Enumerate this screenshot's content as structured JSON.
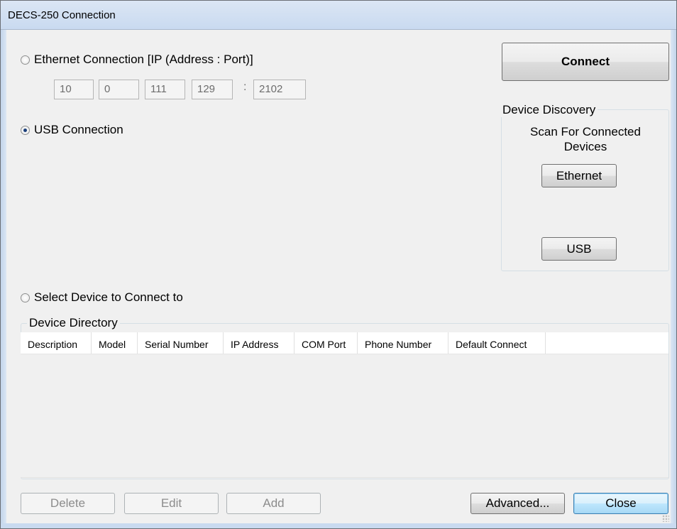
{
  "window": {
    "title": "DECS-250 Connection"
  },
  "ethernet": {
    "radio_label": "Ethernet Connection [IP (Address : Port)]",
    "ip_octets": [
      "10",
      "0",
      "111",
      "129"
    ],
    "port_separator": ":",
    "port": "2102",
    "selected": false
  },
  "usb": {
    "radio_label": "USB Connection",
    "selected": true
  },
  "select_device": {
    "radio_label": "Select Device to Connect to",
    "selected": false
  },
  "connect_button": "Connect",
  "discovery": {
    "title": "Device Discovery",
    "scan_text_line1": "Scan For Connected",
    "scan_text_line2": "Devices",
    "ethernet_button": "Ethernet",
    "usb_button": "USB"
  },
  "directory": {
    "title": "Device Directory",
    "columns": [
      "Description",
      "Model",
      "Serial Number",
      "IP Address",
      "COM Port",
      "Phone Number",
      "Default Connect"
    ],
    "rows": []
  },
  "footer": {
    "delete": "Delete",
    "edit": "Edit",
    "add": "Add",
    "advanced": "Advanced...",
    "close": "Close"
  }
}
